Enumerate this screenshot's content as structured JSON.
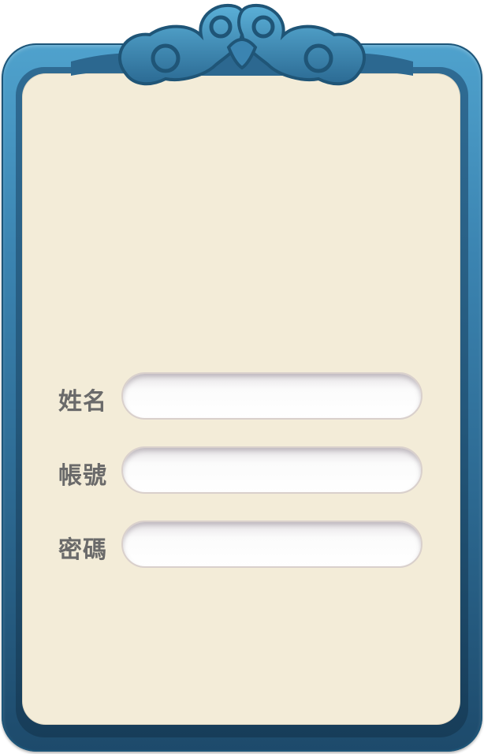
{
  "form": {
    "fields": [
      {
        "label": "姓名",
        "value": "",
        "placeholder": ""
      },
      {
        "label": "帳號",
        "value": "",
        "placeholder": ""
      },
      {
        "label": "密碼",
        "value": "",
        "placeholder": ""
      }
    ]
  },
  "colors": {
    "frame_blue": "#3b84b1",
    "parchment": "#f3ecd8",
    "label_gray": "#6a6a6a"
  },
  "icons": {
    "crest": "ornate-cloud-crest-icon"
  }
}
